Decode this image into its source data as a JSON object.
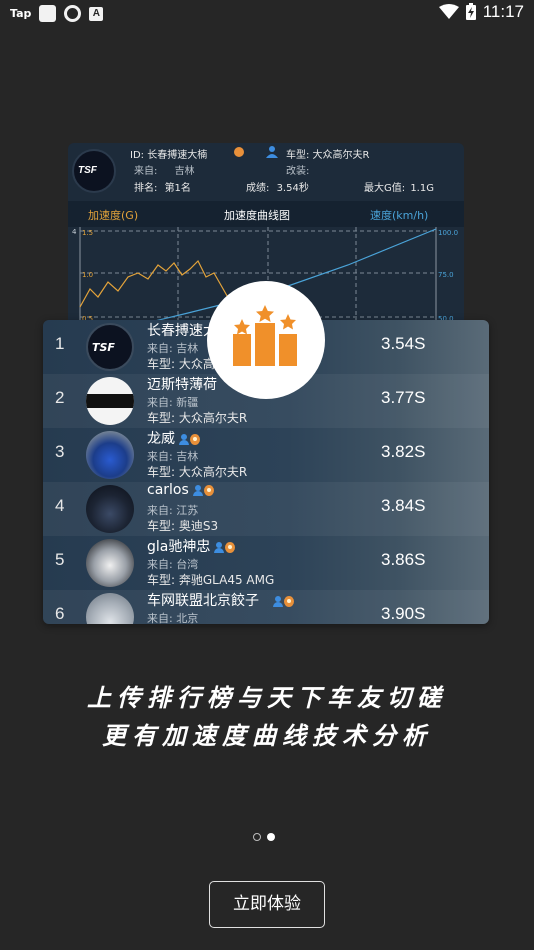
{
  "status_bar": {
    "carrier_icon_text": "Tap",
    "notification_letter": "A",
    "time": "11:17"
  },
  "curve_card": {
    "logo_text": "TSF",
    "id_label": "ID: 长春搏速大楠",
    "car_label": "车型: 大众高尔夫R",
    "from_label": "来自:",
    "from_value": "吉林",
    "mod_label": "改装:",
    "rank_label": "排名:",
    "rank_value": "第1名",
    "score_label": "成绩:",
    "score_value": "3.54秒",
    "maxg_label": "最大G值:",
    "maxg_value": "1.1G",
    "tab_left": "加速度(G)",
    "tab_center": "加速度曲线图",
    "tab_right": "速度(km/h)",
    "axis_left": [
      "1.5",
      "1.0",
      "0.5"
    ],
    "axis_left_top": "4",
    "axis_right": [
      "100.0",
      "75.0",
      "50.0"
    ]
  },
  "ranking": [
    {
      "rank": "1",
      "name": "长春搏速大楠",
      "from": "来自: 吉林",
      "car": "车型: 大众高尔夫R",
      "time": "3.54S",
      "badges": false,
      "avatar": "logo"
    },
    {
      "rank": "2",
      "name": "迈斯特薄荷",
      "from": "来自: 新疆",
      "car": "车型: 大众高尔夫R",
      "time": "3.77S",
      "badges": false,
      "avatar": "text"
    },
    {
      "rank": "3",
      "name": "龙威",
      "from": "来自: 吉林",
      "car": "车型: 大众高尔夫R",
      "time": "3.82S",
      "badges": true,
      "avatar": "car-blue"
    },
    {
      "rank": "4",
      "name": "carlos",
      "from": "来自: 江苏",
      "car": "车型: 奥迪S3",
      "time": "3.84S",
      "badges": true,
      "avatar": "car-dark"
    },
    {
      "rank": "5",
      "name": "gla驰神忠",
      "from": "来自: 台湾",
      "car": "车型: 奔驰GLA45 AMG",
      "time": "3.86S",
      "badges": true,
      "avatar": "car-white"
    },
    {
      "rank": "6",
      "name": "车网联盟北京餃子",
      "from": "来自: 北京",
      "car": "",
      "time": "3.90S",
      "badges": true,
      "avatar": "car-silver"
    }
  ],
  "headline": {
    "line1": "上传排行榜与天下车友切磋",
    "line2": "更有加速度曲线技术分析"
  },
  "pager": {
    "count": 2,
    "active": 1
  },
  "cta_label": "立即体验",
  "colors": {
    "background": "#262626",
    "accent_orange": "#f0902a",
    "chart_yellow": "#e3a33a",
    "chart_blue": "#4aa3d8"
  }
}
